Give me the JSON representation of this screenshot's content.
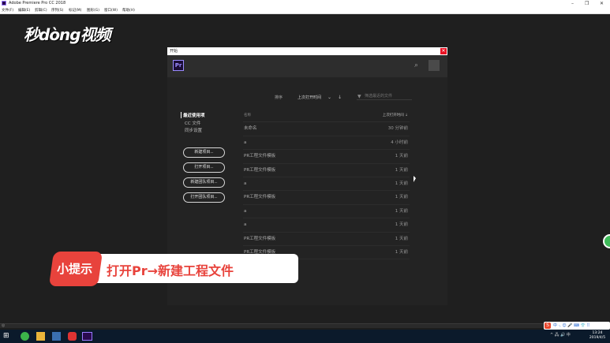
{
  "app": {
    "window_title": "Adobe Premiere Pro CC 2018",
    "menus": [
      "文件(F)",
      "编辑(E)",
      "剪辑(C)",
      "序列(S)",
      "标记(M)",
      "图形(G)",
      "窗口(W)",
      "帮助(H)"
    ],
    "win_controls": {
      "minimize": "–",
      "maximize": "❐",
      "close": "✕"
    }
  },
  "watermark": "秒dòng视频",
  "dialog": {
    "title": "开始",
    "close": "✕",
    "logo": "Pr",
    "sort_label": "排序",
    "sort_value": "上次打开时间",
    "filter_placeholder": "筛选最近的文件",
    "sidebar": {
      "items": [
        "最近使用项",
        "CC 文件",
        "同步设置"
      ],
      "buttons": [
        "新建项目...",
        "打开项目...",
        "新建团队项目...",
        "打开团队项目..."
      ]
    },
    "table": {
      "col_name": "名称",
      "col_time": "上次打开时间 ↓",
      "rows": [
        {
          "name": "未命名",
          "time": "30 分钟前"
        },
        {
          "name": "a",
          "time": "4 小时前"
        },
        {
          "name": "PR工程文件模板",
          "time": "1 天前"
        },
        {
          "name": "PR工程文件模板",
          "time": "1 天前"
        },
        {
          "name": "a",
          "time": "1 天前"
        },
        {
          "name": "PR工程文件模板",
          "time": "1 天前"
        },
        {
          "name": "a",
          "time": "1 天前"
        },
        {
          "name": "a",
          "time": "1 天前"
        },
        {
          "name": "PR工程文件模板",
          "time": "1 天前"
        },
        {
          "name": "PR工程文件模板",
          "time": "1 天前"
        }
      ]
    }
  },
  "tip": {
    "badge": "小提示",
    "text": "打开Pr→新建工程文件"
  },
  "ime": {
    "logo": "S",
    "text": "中 ·, 😊 🎤 ⌨ 👕 ⠿"
  },
  "taskbar": {
    "tray": "^ 🖧 🔊 中",
    "time": "13:24",
    "date": "2019/4/5"
  }
}
